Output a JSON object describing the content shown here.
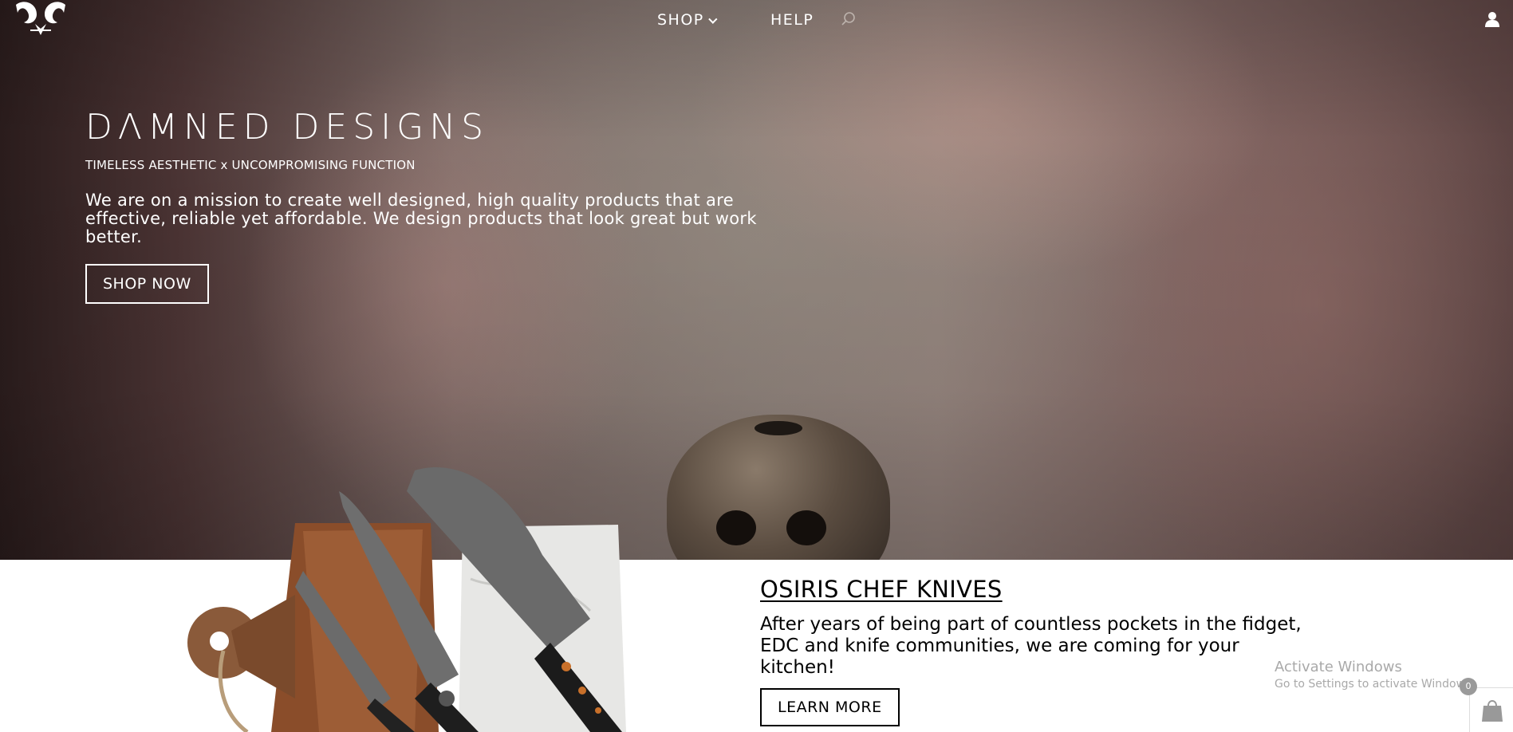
{
  "nav": {
    "logo_icon": "ram-horns-logo",
    "shop_label": "SHOP",
    "help_label": "HELP",
    "search_icon": "search-icon",
    "account_icon": "user-icon"
  },
  "hero": {
    "brand": "DΛMNED DESIGNS",
    "tagline": "TIMELESS AESTHETIC x UNCOMPROMISING FUNCTION",
    "mission": "We are on a mission to create well designed, high quality products that are effective, reliable yet affordable. We design products that look great but work better.",
    "cta_label": "SHOP NOW"
  },
  "promo": {
    "title": "OSIRIS CHEF KNIVES",
    "text": "After years of being part of countless pockets in the fidget, EDC and knife communities, we are coming for your kitchen!",
    "cta_label": "LEARN MORE"
  },
  "watermark": {
    "line1": "Activate Windows",
    "line2": "Go to Settings to activate Windows."
  },
  "cart": {
    "count": "0",
    "icon": "shopping-bag-icon"
  },
  "colors": {
    "text_light": "#ffffff",
    "text_dark": "#000000",
    "badge": "#9a9a9a"
  }
}
